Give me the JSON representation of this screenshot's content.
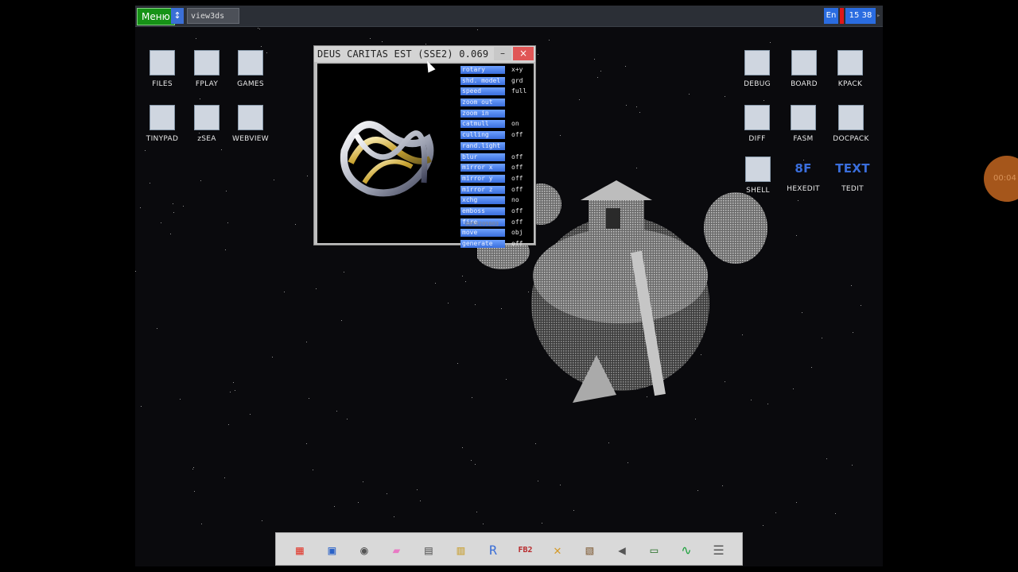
{
  "top_panel": {
    "menu_label": "Меню",
    "switch_glyph": "↕",
    "task_label": "view3ds",
    "lang_label": "En",
    "clock": "15 38"
  },
  "desktop_left": [
    {
      "label": "FILES",
      "icon": "computer-icon"
    },
    {
      "label": "FPLAY",
      "icon": "clapperboard-icon"
    },
    {
      "label": "GAMES",
      "icon": "gamepad-icon"
    },
    {
      "label": "TINYPAD",
      "icon": "notepad-icon"
    },
    {
      "label": "zSEA",
      "icon": "sea-icon"
    },
    {
      "label": "WEBVIEW",
      "icon": "globe-icon"
    }
  ],
  "desktop_right": [
    {
      "label": "DEBUG",
      "icon": "bug-icon"
    },
    {
      "label": "BOARD",
      "icon": "board-icon"
    },
    {
      "label": "KPACK",
      "icon": "wrench-icon"
    },
    {
      "label": "DIFF",
      "icon": "diff-icon"
    },
    {
      "label": "FASM",
      "icon": "fasm-icon"
    },
    {
      "label": "DOCPACK",
      "icon": "drawer-icon"
    },
    {
      "label": "SHELL",
      "icon": "terminal-icon"
    },
    {
      "label": "HEXEDIT",
      "icon": "hex-icon",
      "glyph": "8F"
    },
    {
      "label": "TEDIT",
      "icon": "text-editor-icon",
      "glyph": "TEXT"
    }
  ],
  "window": {
    "title": "DEUS CARITAS EST (SSE2) 0.069",
    "min_glyph": "–",
    "close_glyph": "×",
    "overlay_id": "0050209803",
    "controls": [
      {
        "label": "rotary",
        "value": "x+y"
      },
      {
        "label": "shd. model",
        "value": "grd"
      },
      {
        "label": "speed",
        "value": "full"
      },
      {
        "label": "zoom out",
        "value": ""
      },
      {
        "label": "zoom in",
        "value": ""
      },
      {
        "label": "catmull",
        "value": "on"
      },
      {
        "label": "culling",
        "value": "off"
      },
      {
        "label": "rand.light",
        "value": ""
      },
      {
        "label": "blur",
        "value": "off"
      },
      {
        "label": "mirror x",
        "value": "off"
      },
      {
        "label": "mirror y",
        "value": "off"
      },
      {
        "label": "mirror z",
        "value": "off"
      },
      {
        "label": "xchg",
        "value": "no"
      },
      {
        "label": "emboss",
        "value": "off"
      },
      {
        "label": "fire",
        "value": "off"
      },
      {
        "label": "move",
        "value": "obj"
      },
      {
        "label": "generate",
        "value": "off"
      }
    ]
  },
  "dock": [
    {
      "icon": "cube-icon",
      "glyph": "▦",
      "color": "#e0453a"
    },
    {
      "icon": "chip-icon",
      "glyph": "▣",
      "color": "#2a62c8"
    },
    {
      "icon": "speaker-icon",
      "glyph": "◉",
      "color": "#555555"
    },
    {
      "icon": "eraser-icon",
      "glyph": "▰",
      "color": "#e87ac4"
    },
    {
      "icon": "calculator-icon",
      "glyph": "▤",
      "color": "#666666"
    },
    {
      "icon": "notes-icon",
      "glyph": "▥",
      "color": "#c9a33a"
    },
    {
      "icon": "translate-icon",
      "glyph": "R",
      "color": "#3a6ed6"
    },
    {
      "icon": "fb2-reader-icon",
      "glyph": "FB2",
      "color": "#b8292b"
    },
    {
      "icon": "tools-icon",
      "glyph": "✕",
      "color": "#d49a2a"
    },
    {
      "icon": "archive-icon",
      "glyph": "▧",
      "color": "#8a6b4a"
    },
    {
      "icon": "volume-icon",
      "glyph": "◀",
      "color": "#555555"
    },
    {
      "icon": "monitor-icon",
      "glyph": "▭",
      "color": "#3a7a3a"
    },
    {
      "icon": "system-monitor-icon",
      "glyph": "∿",
      "color": "#1aa03a"
    },
    {
      "icon": "settings-sliders-icon",
      "glyph": "☰",
      "color": "#555555"
    }
  ],
  "recording_badge": "00:04"
}
